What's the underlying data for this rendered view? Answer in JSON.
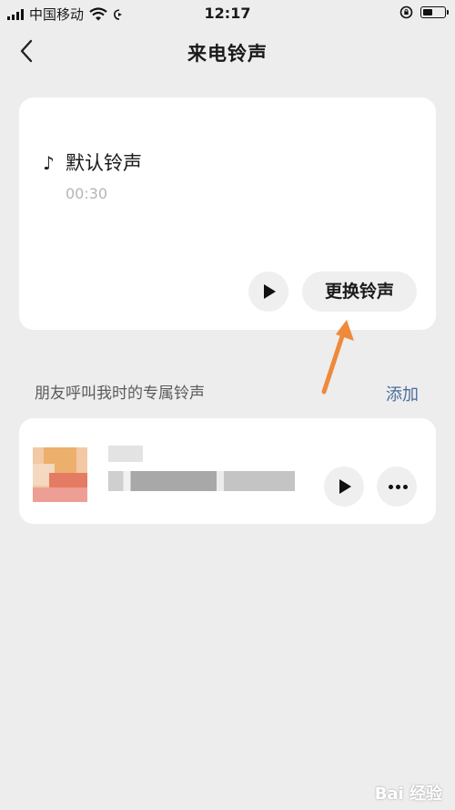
{
  "status_bar": {
    "carrier": "中国移动",
    "time": "12:17",
    "battery_level": 0.45
  },
  "nav": {
    "title": "来电铃声",
    "back_icon": "chevron-left-icon"
  },
  "current_ringtone": {
    "name": "默认铃声",
    "duration": "00:30",
    "change_label": "更换铃声",
    "note_icon": "music-note-icon"
  },
  "friends_section": {
    "title": "朋友呼叫我时的专属铃声",
    "add_label": "添加"
  },
  "watermark": {
    "text": "Bai 经验"
  },
  "colors": {
    "background": "#ededed",
    "card": "#ffffff",
    "link": "#4a6c9c",
    "annotation_arrow": "#f0893a"
  }
}
